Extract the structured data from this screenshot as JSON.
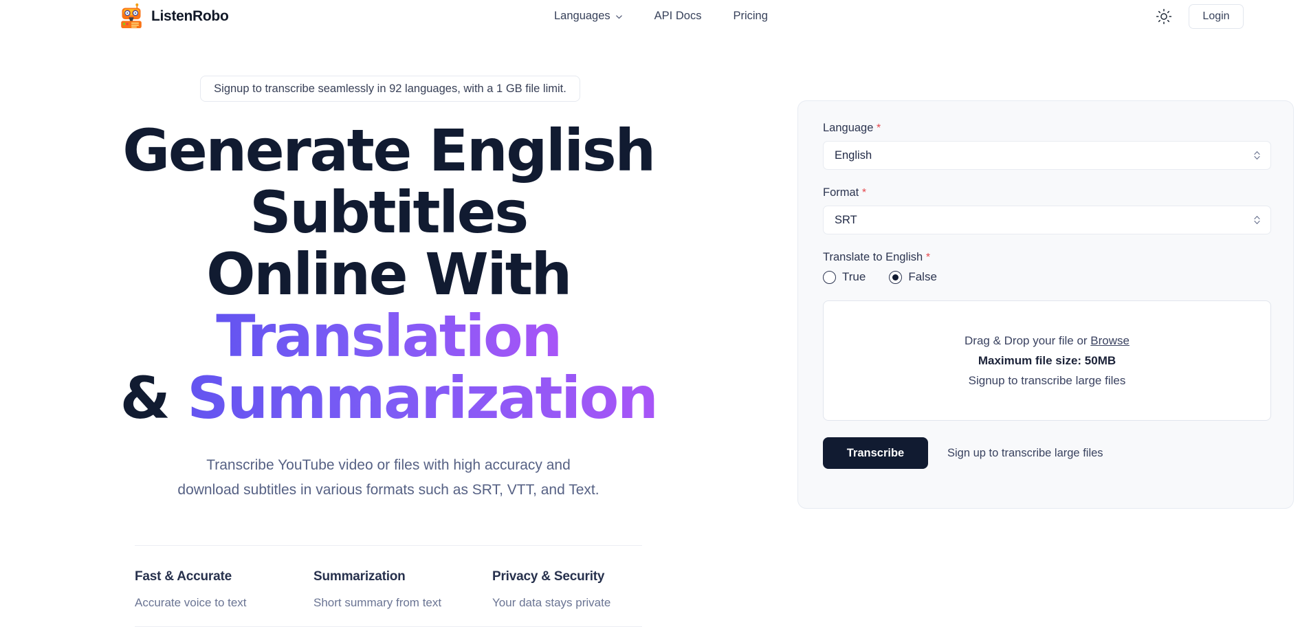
{
  "header": {
    "brand_name": "ListenRobo",
    "brand_icon": "robot-icon",
    "nav": [
      {
        "label": "Languages",
        "icon": "chevron-down-icon",
        "has_chevron": true
      },
      {
        "label": "API Docs",
        "has_chevron": false
      },
      {
        "label": "Pricing",
        "has_chevron": false
      }
    ],
    "theme_toggle_icon": "sun-icon",
    "login_label": "Login"
  },
  "hero": {
    "promo_pill": "Signup to transcribe seamlessly in 92 languages, with a 1 GB file limit.",
    "headline": {
      "line1": "Generate English Subtitles",
      "line2_plain": "Online With ",
      "line2_accent": "Translation",
      "line3_plain": "& ",
      "line3_accent": "Summarization"
    },
    "subtitle_line1": "Transcribe YouTube video or files with high accuracy and",
    "subtitle_line2": "download subtitles in various formats such as SRT, VTT, and Text.",
    "features": [
      {
        "title": "Fast & Accurate",
        "desc": "Accurate voice to text"
      },
      {
        "title": "Summarization",
        "desc": "Short summary from text"
      },
      {
        "title": "Privacy & Security",
        "desc": "Your data stays private"
      }
    ]
  },
  "form": {
    "language": {
      "label": "Language",
      "required_marker": "*",
      "value": "English",
      "icon": "stepper-chevrons-icon"
    },
    "format": {
      "label": "Format",
      "required_marker": "*",
      "value": "SRT",
      "icon": "stepper-chevrons-icon"
    },
    "translate": {
      "label": "Translate to English",
      "required_marker": "*",
      "options": [
        {
          "label": "True",
          "selected": false
        },
        {
          "label": "False",
          "selected": true
        }
      ]
    },
    "dropzone": {
      "prompt_prefix": "Drag & Drop your file or ",
      "browse_label": "Browse",
      "max_size": "Maximum file size: 50MB",
      "signup_note": "Signup to transcribe large files"
    },
    "transcribe_label": "Transcribe",
    "signup_large_files": "Sign up to transcribe large files"
  },
  "colors": {
    "accent_gradient_start": "#6354f0",
    "accent_gradient_end": "#a855f7",
    "headline_dark": "#111b31",
    "brand_orange": "#f97316",
    "required_red": "#e5484d",
    "panel_bg": "#f8f9fb",
    "button_dark": "#111b31"
  }
}
